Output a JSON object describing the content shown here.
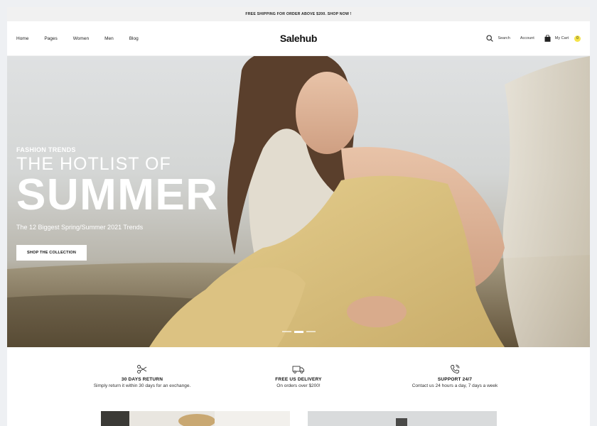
{
  "topbar": {
    "promo": "FREE SHIPPING FOR ORDER ABOVE $200. SHOP NOW !"
  },
  "nav": {
    "links": [
      "Home",
      "Pages",
      "Women",
      "Men",
      "Blog"
    ],
    "logo": "Salehub",
    "search_label": "Search",
    "account_label": "Account",
    "cart_label": "My Cart",
    "cart_count": "0"
  },
  "hero": {
    "eyebrow": "FASHION TRENDS",
    "headline": "THE HOTLIST OF",
    "headline_big": "SUMMER",
    "description": "The 12 Biggest Spring/Summer 2021 Trends",
    "cta_label": "SHOP THE COLLECTION",
    "slides": 3,
    "active_slide": 2
  },
  "features": [
    {
      "icon": "scissors-icon",
      "title": "30 DAYS RETURN",
      "desc": "Simply return it within 30 days for an exchange."
    },
    {
      "icon": "truck-icon",
      "title": "FREE US DELIVERY",
      "desc": "On orders over $200!"
    },
    {
      "icon": "phone-icon",
      "title": "SUPPORT 24/7",
      "desc": "Contact us 24 hours a day, 7 days a week"
    }
  ],
  "colors": {
    "accent": "#f5e44a",
    "topbar": "#f1f1f1"
  }
}
